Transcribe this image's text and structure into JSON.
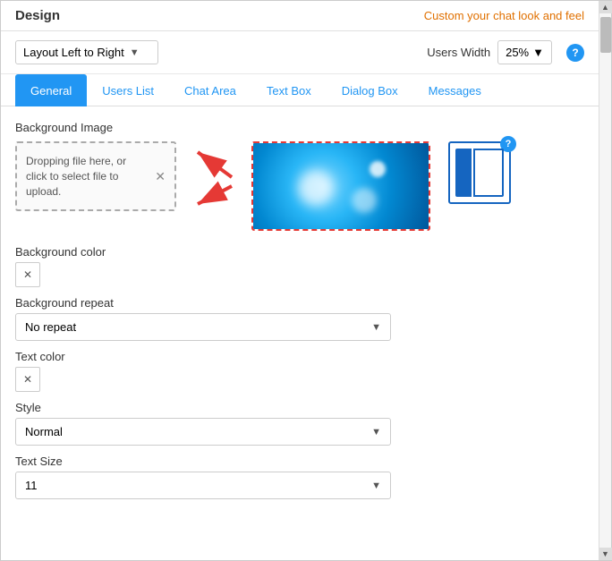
{
  "header": {
    "title": "Design",
    "subtitle": "Custom your chat look and feel"
  },
  "toolbar": {
    "layout_label": "Layout Left to Right",
    "layout_arrow": "▼",
    "users_width_label": "Users Width",
    "users_width_value": "25%",
    "users_width_arrow": "▼"
  },
  "tabs": [
    {
      "id": "general",
      "label": "General",
      "active": true
    },
    {
      "id": "users-list",
      "label": "Users List",
      "active": false
    },
    {
      "id": "chat-area",
      "label": "Chat Area",
      "active": false
    },
    {
      "id": "text-box",
      "label": "Text Box",
      "active": false
    },
    {
      "id": "dialog-box",
      "label": "Dialog Box",
      "active": false
    },
    {
      "id": "messages",
      "label": "Messages",
      "active": false
    }
  ],
  "general": {
    "bg_image_label": "Background Image",
    "upload_text": "Dropping file here, or click to select file to upload.",
    "bg_color_label": "Background color",
    "bg_repeat_label": "Background repeat",
    "bg_repeat_value": "No repeat",
    "text_color_label": "Text color",
    "style_label": "Style",
    "style_value": "Normal",
    "text_size_label": "Text Size",
    "text_size_value": "11"
  },
  "icons": {
    "close": "✕",
    "arrow_down": "▼",
    "help": "?",
    "scroll_up": "▲",
    "scroll_down": "▼",
    "x_mark": "✕"
  }
}
